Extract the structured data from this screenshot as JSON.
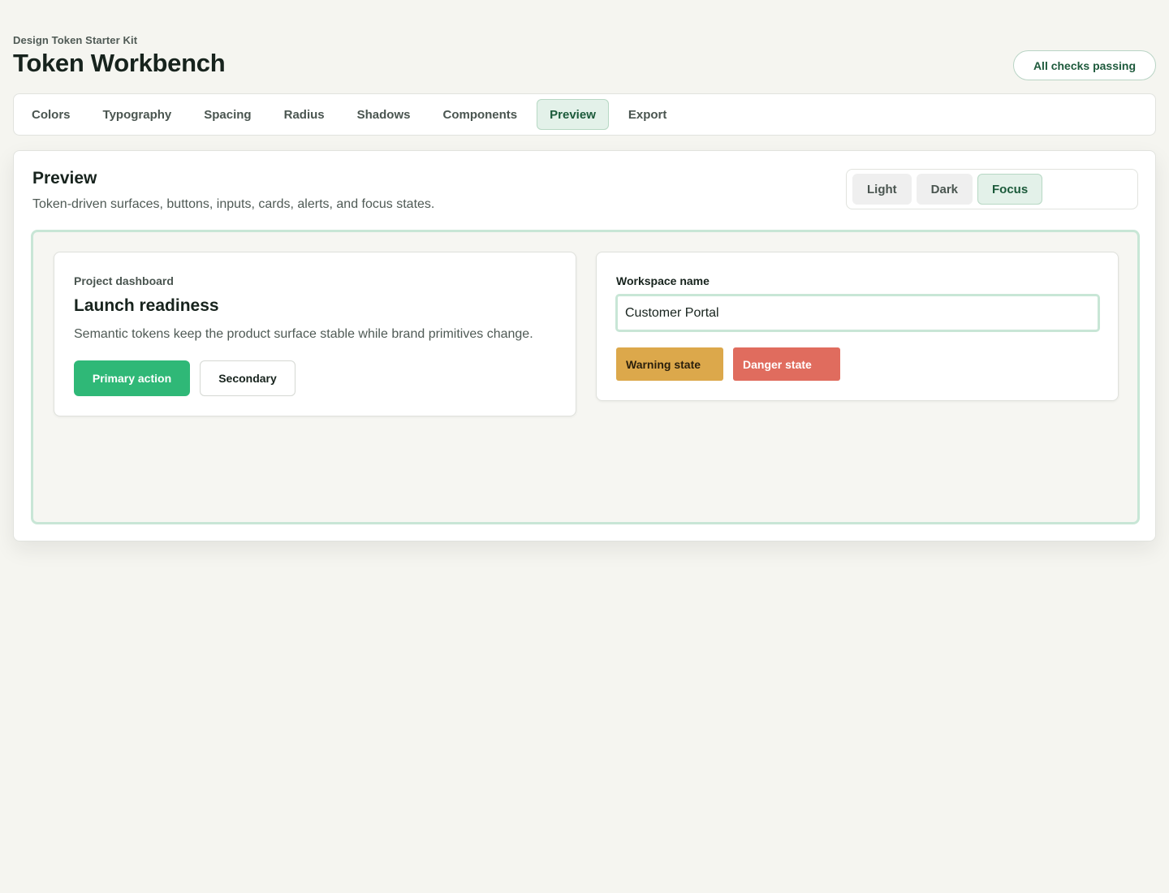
{
  "header": {
    "kicker": "Design Token Starter Kit",
    "title": "Token Workbench",
    "status": "All checks passing"
  },
  "tabs": [
    {
      "label": "Colors"
    },
    {
      "label": "Typography"
    },
    {
      "label": "Spacing"
    },
    {
      "label": "Radius"
    },
    {
      "label": "Shadows"
    },
    {
      "label": "Components"
    },
    {
      "label": "Preview",
      "active": true
    },
    {
      "label": "Export"
    }
  ],
  "panel": {
    "title": "Preview",
    "subtitle": "Token-driven surfaces, buttons, inputs, cards, alerts, and focus states.",
    "modes": [
      {
        "label": "Light"
      },
      {
        "label": "Dark"
      },
      {
        "label": "Focus",
        "active": true
      }
    ]
  },
  "dashboard_card": {
    "eyebrow": "Project dashboard",
    "title": "Launch readiness",
    "body": "Semantic tokens keep the product surface stable while brand primitives change.",
    "primary_label": "Primary action",
    "secondary_label": "Secondary"
  },
  "form_card": {
    "field_label": "Workspace name",
    "field_value": "Customer Portal",
    "warning_label": "Warning state",
    "danger_label": "Danger state"
  },
  "colors": {
    "primary": "#2fb877",
    "warning": "#dca84b",
    "danger": "#e06c5e",
    "focus_ring": "#c8e6d6",
    "active_tab_bg": "#e3f1e9"
  }
}
